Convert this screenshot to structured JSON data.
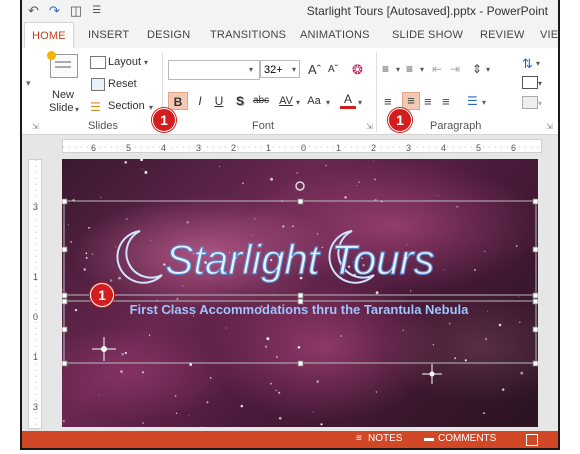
{
  "window": {
    "title": "Starlight Tours [Autosaved].pptx - PowerPoint"
  },
  "tabs": [
    {
      "label": "HOME",
      "active": true
    },
    {
      "label": "INSERT"
    },
    {
      "label": "DESIGN"
    },
    {
      "label": "TRANSITIONS"
    },
    {
      "label": "ANIMATIONS"
    },
    {
      "label": "SLIDE SHOW"
    },
    {
      "label": "REVIEW"
    },
    {
      "label": "VIEW"
    }
  ],
  "slides_group": {
    "label": "Slides",
    "new_slide": "New",
    "new_slide_2": "Slide",
    "layout": "Layout",
    "reset": "Reset",
    "section": "Section"
  },
  "font_group": {
    "label": "Font",
    "font_size": "32+",
    "bold": "B",
    "italic": "I",
    "underline": "U",
    "shadow": "S",
    "strike": "abc",
    "spacing": "AV",
    "case": "Aa",
    "color": "A"
  },
  "paragraph_group": {
    "label": "Paragraph"
  },
  "badges": {
    "b1": "1",
    "b2": "1",
    "b3": "1"
  },
  "ruler": {
    "marks": [
      "6",
      "5",
      "4",
      "3",
      "2",
      "1",
      "0",
      "1",
      "2",
      "3",
      "4",
      "5",
      "6"
    ]
  },
  "slide": {
    "title": "Starlight Tours",
    "subtitle": "First Class Accommodations thru the Tarantula Nebula"
  },
  "status": {
    "notes": "NOTES",
    "comments": "COMMENTS"
  },
  "colors": {
    "accent": "#c43e1c",
    "status_bar": "#d24726",
    "badge": "#d21e1e"
  }
}
